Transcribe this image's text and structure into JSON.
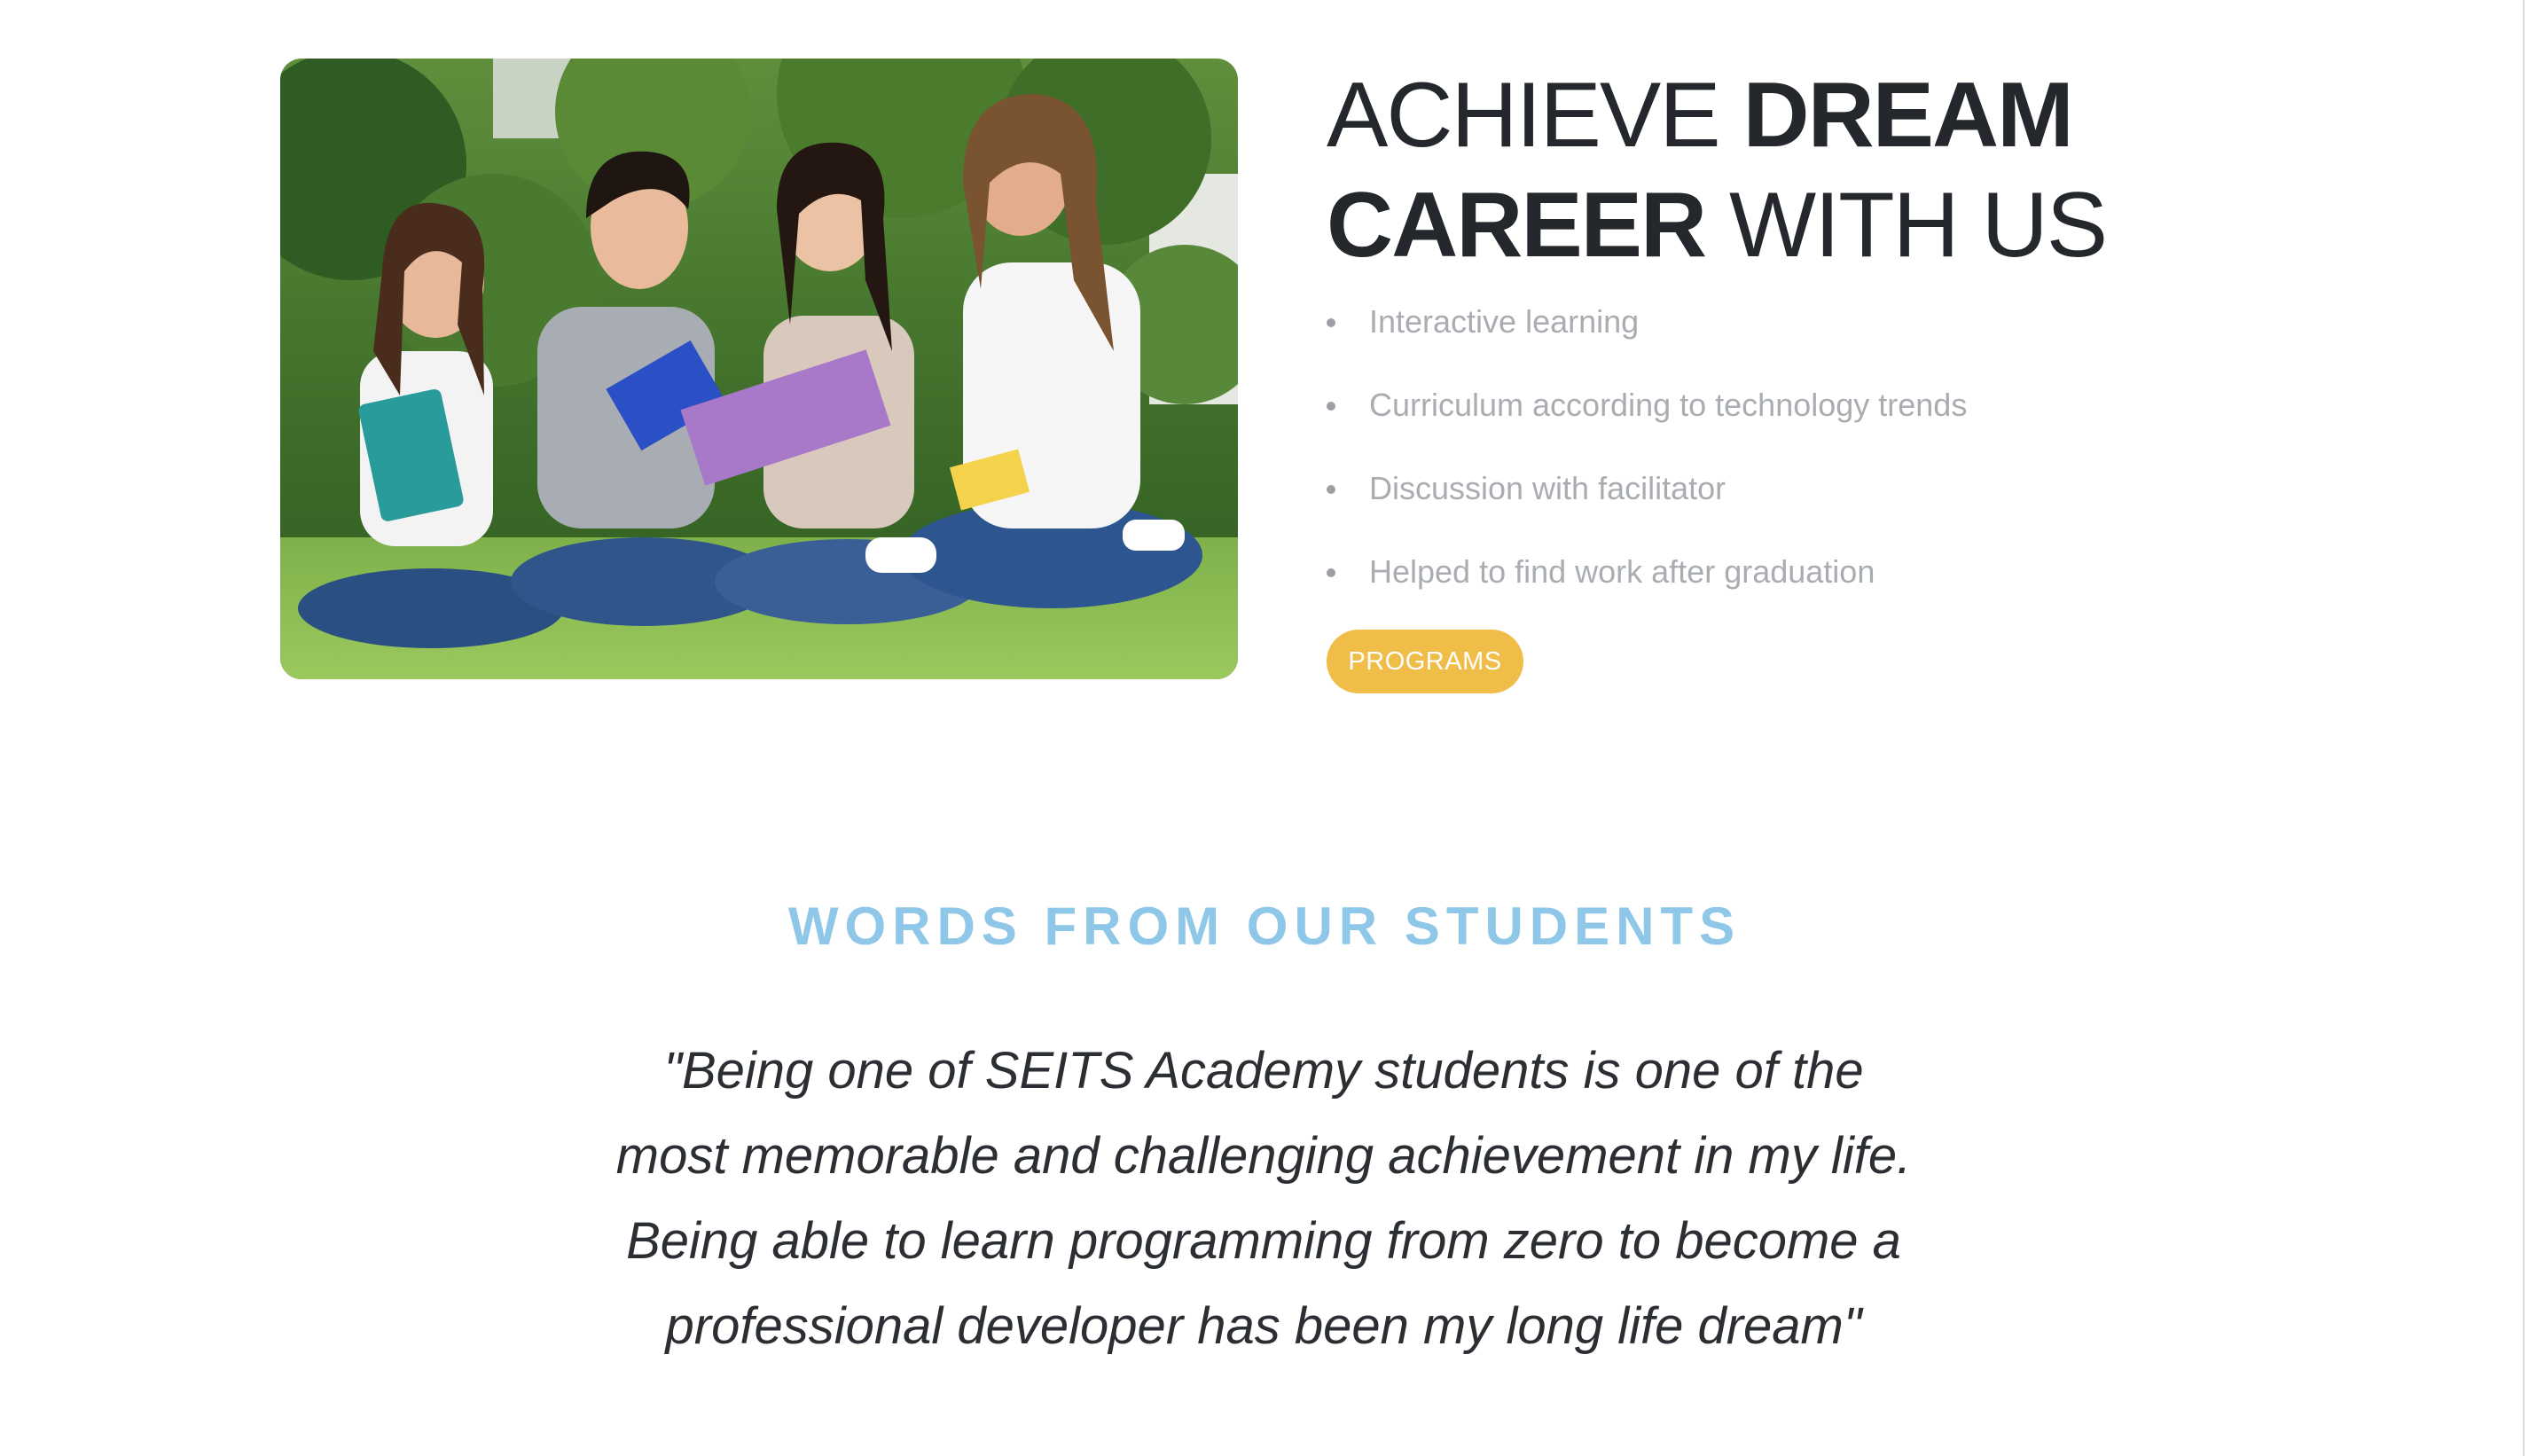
{
  "hero": {
    "image_alt": "Four students sitting on the grass with notebooks, laughing together",
    "headline": {
      "part1": "ACHIEVE ",
      "part2": "DREAM",
      "part3": "CAREER",
      "part4": " WITH US"
    },
    "features": [
      "Interactive learning",
      "Curriculum according to technology trends",
      "Discussion with facilitator",
      "Helped to find work after graduation"
    ],
    "cta_label": "PROGRAMS"
  },
  "testimonials": {
    "title": "WORDS FROM OUR STUDENTS",
    "quote": "\"Being one of SEITS Academy students is one of the most memorable and challenging achievement in my life. Being able to learn programming from zero to become a professional developer has been my long life dream\""
  },
  "colors": {
    "accent_button": "#f0bd48",
    "section_title": "#8fc7e8",
    "heading_text": "#24272b",
    "feature_text": "#a9adb2"
  },
  "icons": {
    "list_bullet": "bullet-dot"
  }
}
